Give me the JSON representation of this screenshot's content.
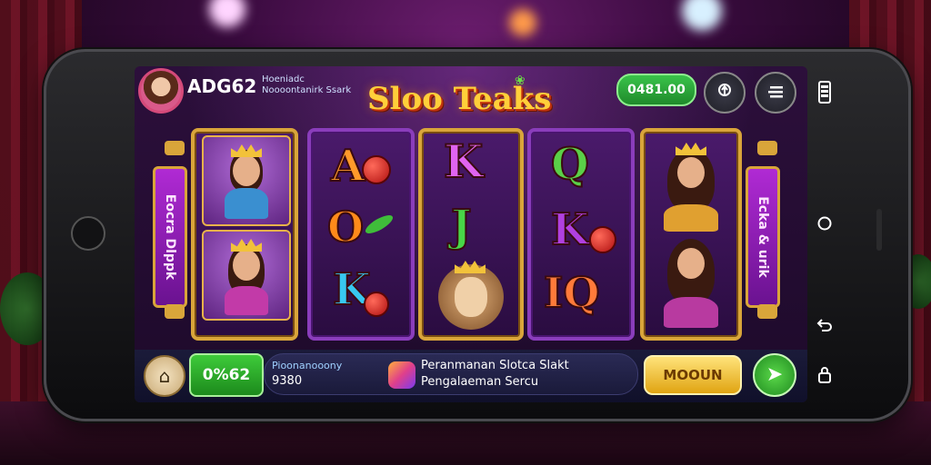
{
  "header": {
    "player_name": "ADG62",
    "player_sub_line1": "Hoeniadc",
    "player_sub_line2": "Noooontanirk Ssark",
    "game_title": "Sloo Teaks",
    "balance": "0481.00",
    "icons": [
      "lock-icon",
      "menu-icon"
    ]
  },
  "reels": {
    "symbols_reel2": [
      "A",
      "O",
      "K"
    ],
    "symbols_reel3": [
      "K",
      "J"
    ],
    "symbols_reel4": [
      "Q",
      "K",
      "IQ"
    ]
  },
  "side_banners": {
    "left": "Eocra Dlppk",
    "right": "Ecka & urik"
  },
  "bottom_bar": {
    "bet_value": "0%62",
    "info_label": "Pioonanooony",
    "info_value": "9380",
    "promo_line1": "Peranmanan Slotca Slakt",
    "promo_line2": "Pengalaeman Sercu",
    "action_label": "MOOUN"
  },
  "phone_nav_icons": [
    "battery-icon",
    "circle-icon",
    "back-icon",
    "lock-icon"
  ]
}
